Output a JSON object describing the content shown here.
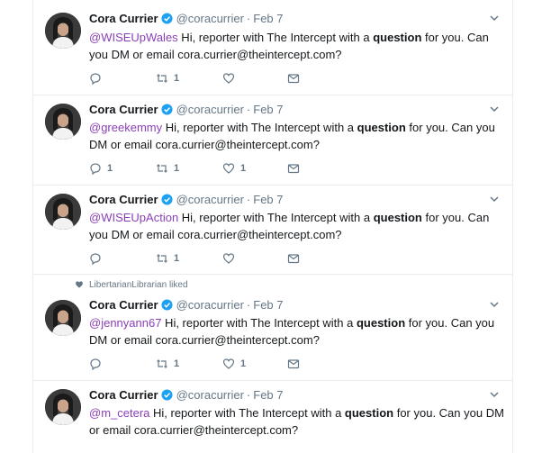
{
  "tweets": [
    {
      "name": "Cora Currier",
      "handle": "@coracurrier",
      "separator": "·",
      "date": "Feb 7",
      "mention": "@WISEUpWales",
      "text_before": " Hi, reporter with The Intercept with a ",
      "text_bold": "question",
      "text_after": " for you. Can you DM or email cora.currier@theintercept.com?",
      "reply_count": "",
      "retweet_count": "1",
      "like_count": "",
      "liked_by": ""
    },
    {
      "name": "Cora Currier",
      "handle": "@coracurrier",
      "separator": "·",
      "date": "Feb 7",
      "mention": "@greekemmy",
      "text_before": " Hi, reporter with The Intercept with a ",
      "text_bold": "question",
      "text_after": " for you. Can you DM or email cora.currier@theintercept.com?",
      "reply_count": "1",
      "retweet_count": "1",
      "like_count": "1",
      "liked_by": ""
    },
    {
      "name": "Cora Currier",
      "handle": "@coracurrier",
      "separator": "·",
      "date": "Feb 7",
      "mention": "@WISEUpAction",
      "text_before": " Hi, reporter with The Intercept with a ",
      "text_bold": "question",
      "text_after": " for you. Can you DM or email cora.currier@theintercept.com?",
      "reply_count": "",
      "retweet_count": "1",
      "like_count": "",
      "liked_by": ""
    },
    {
      "name": "Cora Currier",
      "handle": "@coracurrier",
      "separator": "·",
      "date": "Feb 7",
      "mention": "@jennyann67",
      "text_before": " Hi, reporter with The Intercept with a ",
      "text_bold": "question",
      "text_after": " for you. Can you DM or email cora.currier@theintercept.com?",
      "reply_count": "",
      "retweet_count": "1",
      "like_count": "1",
      "liked_by": "LibertarianLibrarian liked"
    },
    {
      "name": "Cora Currier",
      "handle": "@coracurrier",
      "separator": "·",
      "date": "Feb 7",
      "mention": "@m_cetera",
      "text_before": " Hi, reporter with The Intercept with a ",
      "text_bold": "question",
      "text_after": " for you. Can you DM or email cora.currier@theintercept.com?",
      "reply_count": "",
      "retweet_count": "",
      "like_count": "",
      "liked_by": ""
    }
  ],
  "colors": {
    "mention": "#8b3fb8",
    "verified": "#1da1f2",
    "muted": "#657786",
    "divider": "#e6ecf0"
  },
  "icons": {
    "reply": "reply-icon",
    "retweet": "retweet-icon",
    "like": "heart-icon",
    "message": "envelope-icon",
    "verified": "verified-badge-icon",
    "menu": "chevron-down-icon"
  }
}
